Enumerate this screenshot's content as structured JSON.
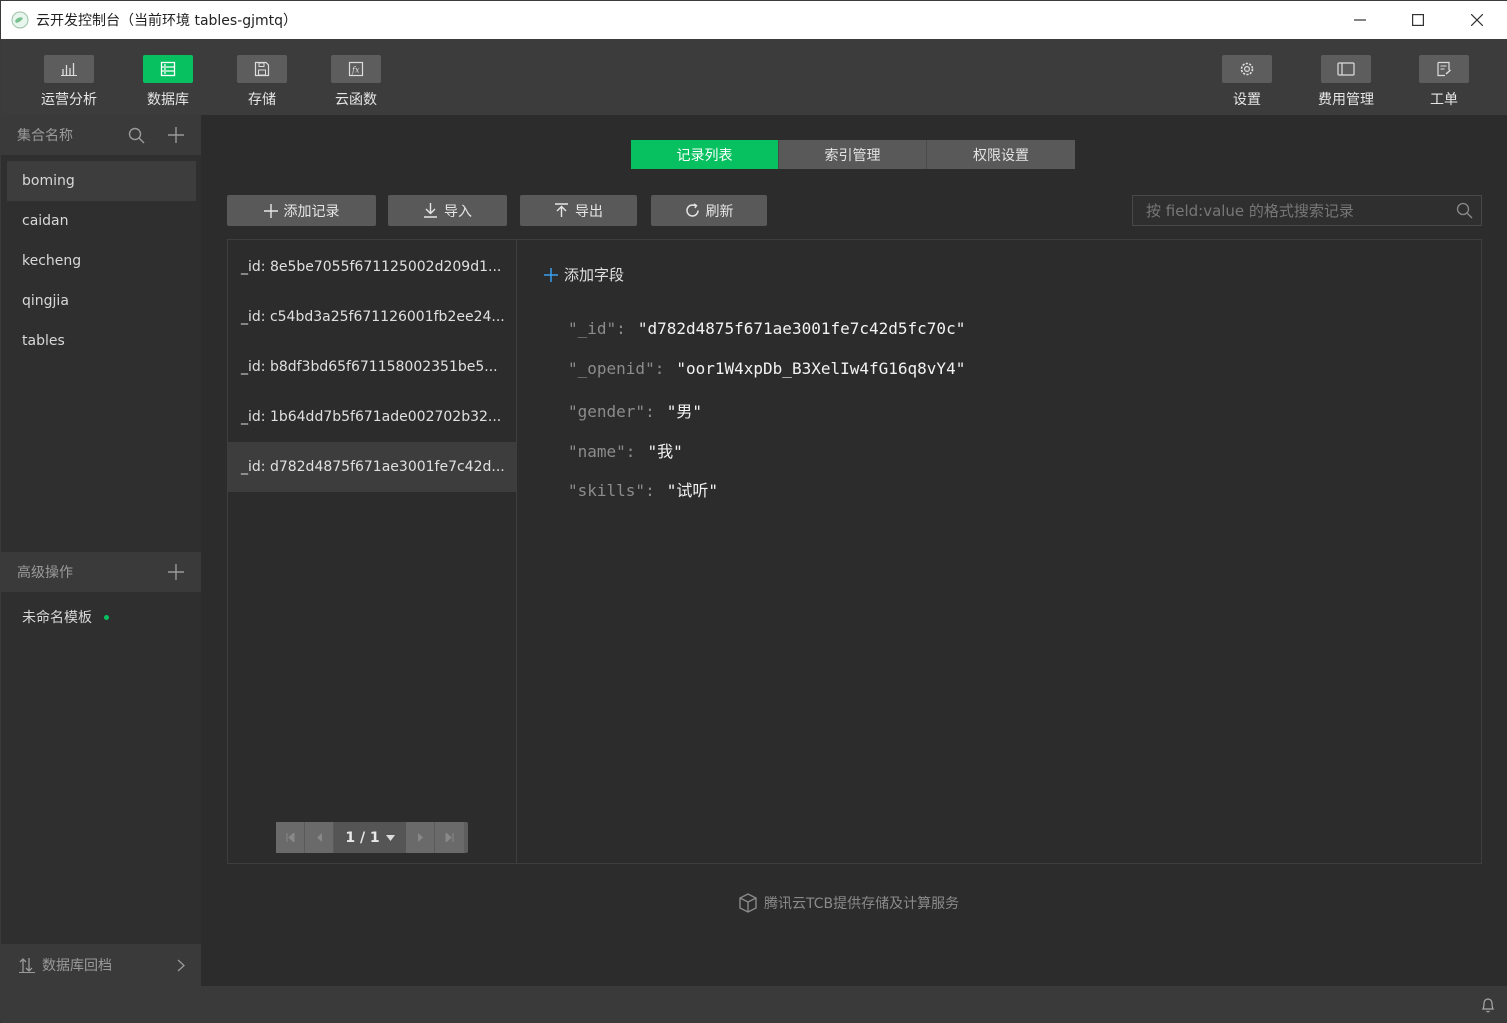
{
  "window": {
    "title": "云开发控制台（当前环境 tables-gjmtq）"
  },
  "toolbar": {
    "left": [
      {
        "label": "运营分析",
        "icon": "chart-icon"
      },
      {
        "label": "数据库",
        "icon": "database-icon",
        "active": true
      },
      {
        "label": "存储",
        "icon": "storage-icon"
      },
      {
        "label": "云函数",
        "icon": "function-icon"
      }
    ],
    "right": [
      {
        "label": "设置",
        "icon": "gear-icon"
      },
      {
        "label": "费用管理",
        "icon": "billing-icon"
      },
      {
        "label": "工单",
        "icon": "ticket-icon"
      }
    ]
  },
  "sidebar": {
    "collections_header": "集合名称",
    "collections": [
      "boming",
      "caidan",
      "kecheng",
      "qingjia",
      "tables"
    ],
    "selected_collection": "boming",
    "advanced_header": "高级操作",
    "templates": [
      "未命名模板"
    ],
    "footer_label": "数据库回档"
  },
  "tabs": [
    {
      "label": "记录列表",
      "active": true
    },
    {
      "label": "索引管理"
    },
    {
      "label": "权限设置"
    }
  ],
  "actions": {
    "add": "添加记录",
    "import": "导入",
    "export": "导出",
    "refresh": "刷新"
  },
  "search": {
    "placeholder": "按 field:value 的格式搜索记录"
  },
  "records": [
    "_id: 8e5be7055f671125002d209d1...",
    "_id: c54bd3a25f671126001fb2ee24...",
    "_id: b8df3bd65f671158002351be5...",
    "_id: 1b64dd7b5f671ade002702b32...",
    "_id: d782d4875f671ae3001fe7c42d..."
  ],
  "selected_record_index": 4,
  "pager": {
    "label": "1 / 1"
  },
  "detail": {
    "add_field": "添加字段",
    "fields": [
      {
        "key": "\"_id\"",
        "value": "\"d782d4875f671ae3001fe7c42d5fc70c\""
      },
      {
        "key": "\"_openid\"",
        "value": "\"oor1W4xpDb_B3XelIw4fG16q8vY4\""
      },
      {
        "key": "\"gender\"",
        "value": "\"男\""
      },
      {
        "key": "\"name\"",
        "value": "\"我\""
      },
      {
        "key": "\"skills\"",
        "value": "\"试听\""
      }
    ]
  },
  "footer": {
    "credit": "腾讯云TCB提供存储及计算服务"
  },
  "colors": {
    "accent": "#07c160",
    "background": "#2c2c2c",
    "toolbar": "#3c3c3c"
  }
}
